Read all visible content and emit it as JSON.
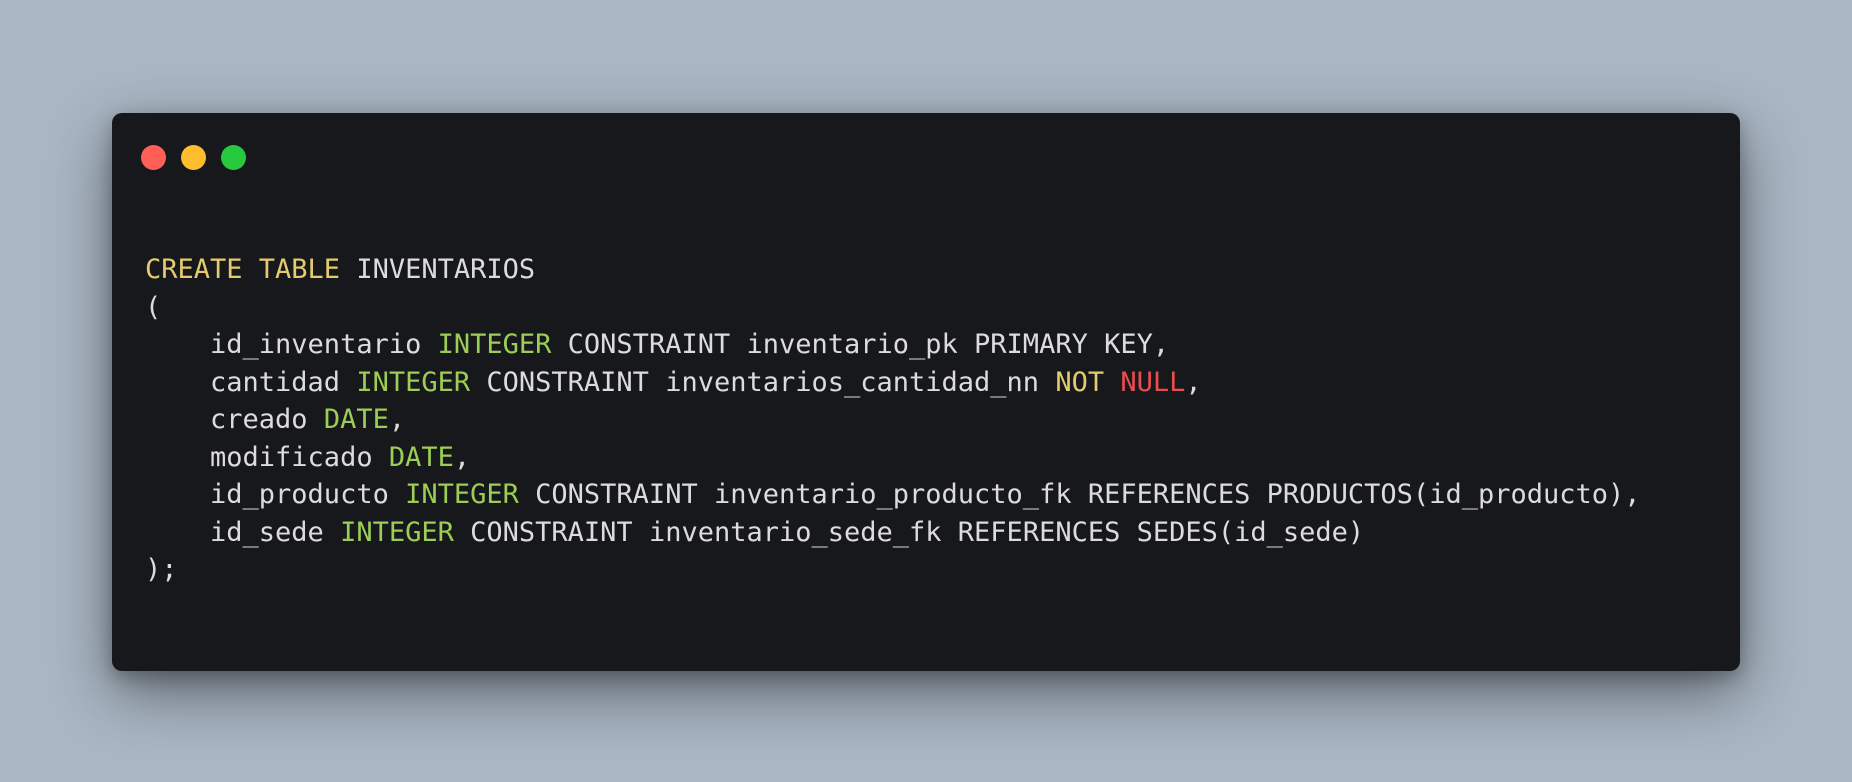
{
  "window": {
    "controls": [
      {
        "name": "close",
        "color": "#ff5f56"
      },
      {
        "name": "minimize",
        "color": "#ffbd2e"
      },
      {
        "name": "maximize",
        "color": "#27c93f"
      }
    ]
  },
  "code": {
    "colors": {
      "keyword": "#e4cb6f",
      "type": "#9ccd57",
      "null": "#ea4d4d",
      "plain": "#dcdcdc"
    },
    "lines": [
      [
        {
          "t": "CREATE TABLE",
          "c": "kw"
        },
        {
          "t": " INVENTARIOS",
          "c": "plain"
        }
      ],
      [
        {
          "t": "(",
          "c": "plain"
        }
      ],
      [
        {
          "t": "    id_inventario ",
          "c": "plain"
        },
        {
          "t": "INTEGER",
          "c": "type"
        },
        {
          "t": " CONSTRAINT inventario_pk PRIMARY KEY,",
          "c": "plain"
        }
      ],
      [
        {
          "t": "    cantidad ",
          "c": "plain"
        },
        {
          "t": "INTEGER",
          "c": "type"
        },
        {
          "t": " CONSTRAINT inventarios_cantidad_nn ",
          "c": "plain"
        },
        {
          "t": "NOT",
          "c": "kw"
        },
        {
          "t": " ",
          "c": "plain"
        },
        {
          "t": "NULL",
          "c": "null"
        },
        {
          "t": ",",
          "c": "plain"
        }
      ],
      [
        {
          "t": "    creado ",
          "c": "plain"
        },
        {
          "t": "DATE",
          "c": "type"
        },
        {
          "t": ",",
          "c": "plain"
        }
      ],
      [
        {
          "t": "    modificado ",
          "c": "plain"
        },
        {
          "t": "DATE",
          "c": "type"
        },
        {
          "t": ",",
          "c": "plain"
        }
      ],
      [
        {
          "t": "    id_producto ",
          "c": "plain"
        },
        {
          "t": "INTEGER",
          "c": "type"
        },
        {
          "t": " CONSTRAINT inventario_producto_fk REFERENCES PRODUCTOS(id_producto),",
          "c": "plain"
        }
      ],
      [
        {
          "t": "    id_sede ",
          "c": "plain"
        },
        {
          "t": "INTEGER",
          "c": "type"
        },
        {
          "t": " CONSTRAINT inventario_sede_fk REFERENCES SEDES(id_sede)",
          "c": "plain"
        }
      ],
      [
        {
          "t": ");",
          "c": "plain"
        }
      ]
    ]
  }
}
